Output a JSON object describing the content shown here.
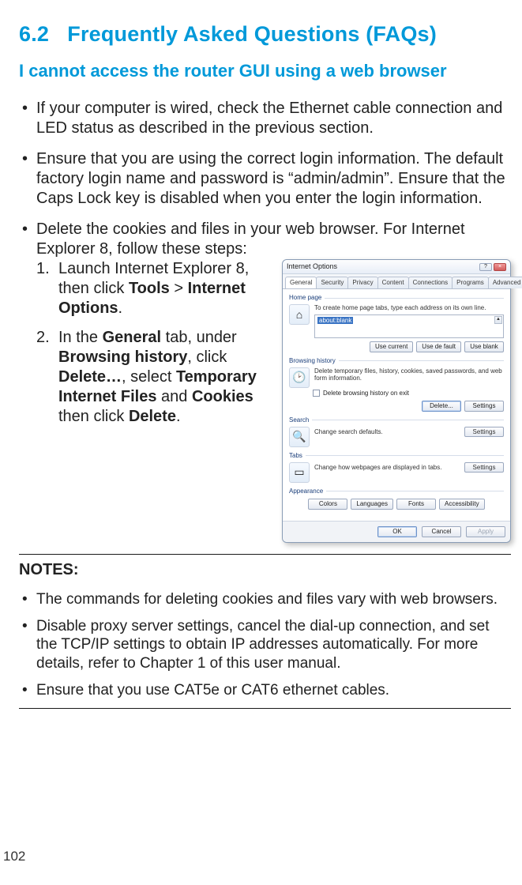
{
  "heading_num": "6.2",
  "heading_text": "Frequently Asked Questions (FAQs)",
  "subheading": "I cannot access the router GUI using a web browser",
  "bullets": {
    "b1": "If your computer is wired, check the Ethernet cable connection and LED status as described in the previous section.",
    "b2": "Ensure that you are using the correct login information. The default factory login name and password is “admin/admin”. Ensure that the Caps Lock key is disabled when you enter the login information.",
    "b3": "Delete the cookies and files in your web browser. For Internet Explorer 8, follow these steps:"
  },
  "steps": {
    "s1_a": "Launch Internet Explorer 8, then click ",
    "s1_tools": "Tools",
    "s1_gt": " > ",
    "s1_io": "Internet Options",
    "s1_dot": ".",
    "s2_a": "In the ",
    "s2_general": "General",
    "s2_b": " tab, under ",
    "s2_bh": "Browsing history",
    "s2_c": ", click ",
    "s2_del": "Delete…",
    "s2_d": ", select ",
    "s2_tif": "Temporary Internet Files",
    "s2_e": " and ",
    "s2_cookies": "Cookies",
    "s2_f": " then click ",
    "s2_delete": "Delete",
    "s2_g": "."
  },
  "dialog": {
    "title": "Internet Options",
    "help": "?",
    "close": "×",
    "tabs": [
      "General",
      "Security",
      "Privacy",
      "Content",
      "Connections",
      "Programs",
      "Advanced"
    ],
    "homepage": {
      "title": "Home page",
      "desc": "To create home page tabs, type each address on its own line.",
      "value": "about:blank",
      "btns": [
        "Use current",
        "Use de fault",
        "Use blank"
      ]
    },
    "history": {
      "title": "Browsing history",
      "desc": "Delete temporary files, history, cookies, saved passwords, and web form information.",
      "chk": "Delete browsing history on exit",
      "btns": [
        "Delete...",
        "Settings"
      ]
    },
    "search": {
      "title": "Search",
      "desc": "Change search defaults.",
      "btn": "Settings"
    },
    "tabs_group": {
      "title": "Tabs",
      "desc": "Change how webpages are displayed in tabs.",
      "btn": "Settings"
    },
    "appearance": {
      "title": "Appearance",
      "btns": [
        "Colors",
        "Languages",
        "Fonts",
        "Accessibility"
      ]
    },
    "footer": [
      "OK",
      "Cancel",
      "Apply"
    ]
  },
  "notes_title": "NOTES:",
  "notes": {
    "n1": "The commands for deleting cookies and files vary with web browsers.",
    "n2": "Disable proxy server settings, cancel the dial-up connection, and set the TCP/IP settings to obtain IP addresses automatically. For more details, refer to Chapter 1 of this user manual.",
    "n3": "Ensure that you use CAT5e or CAT6 ethernet cables."
  },
  "page_number": "102"
}
